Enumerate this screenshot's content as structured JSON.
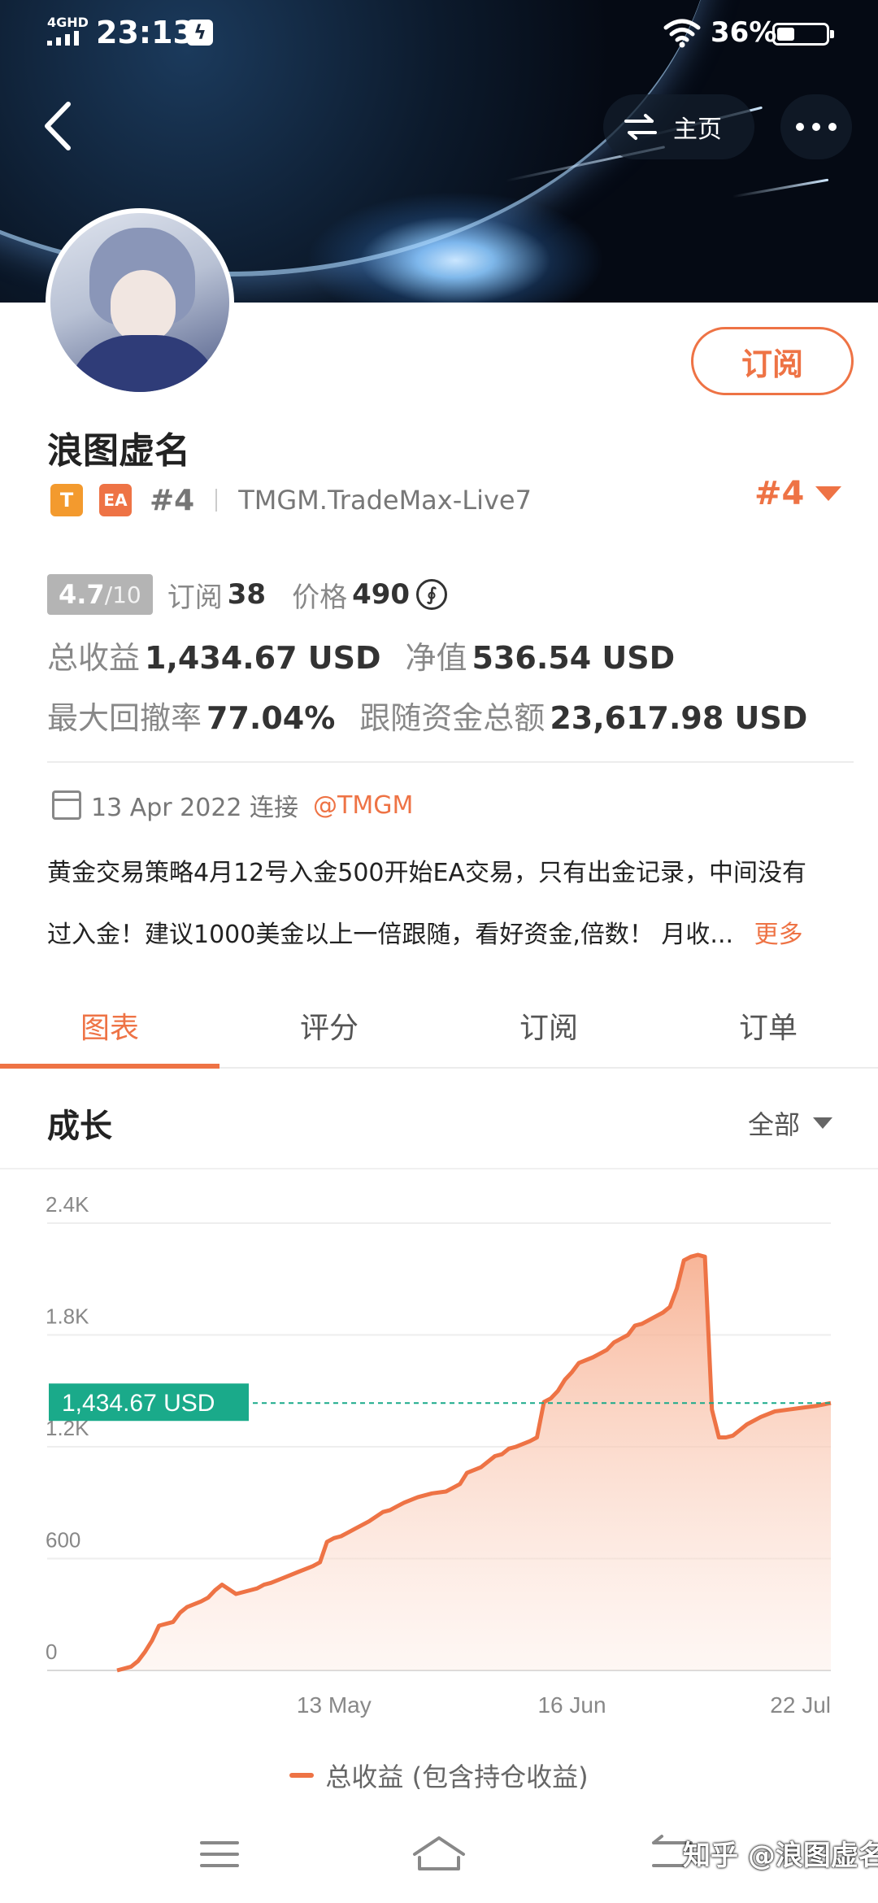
{
  "status_bar": {
    "network": "4GHD",
    "time": "23:13",
    "battery": "36%",
    "battery_level": 0.36
  },
  "top_nav": {
    "home_label": "主页"
  },
  "profile": {
    "name": "浪图虚名",
    "tag_t": "T",
    "tag_ea": "EA",
    "rank_small": "#4",
    "broker": "TMGM.TradeMax-Live7",
    "rank_big": "#4",
    "subscribe_label": "订阅"
  },
  "stats": {
    "score": "4.7",
    "score_max": "/10",
    "subscribe_label": "订阅",
    "subscribe_count": "38",
    "price_label": "价格",
    "price_value": "490",
    "coin_symbol": "∮",
    "total_profit_label": "总收益",
    "total_profit_value": "1,434.67 USD",
    "equity_label": "净值",
    "equity_value": "536.54 USD",
    "drawdown_label": "最大回撤率",
    "drawdown_value": "77.04%",
    "follow_label": "跟随资金总额",
    "follow_value": "23,617.98 USD"
  },
  "since": {
    "date_text": "13 Apr 2022 连接",
    "broker_tag": "@TMGM"
  },
  "description": {
    "line1": "黄金交易策略4月12号入金500开始EA交易，只有出金记录，中间没有",
    "line2": "过入金！建议1000美金以上一倍跟随，看好资金,倍数！ 月收...",
    "more": "更多"
  },
  "tabs": [
    "图表",
    "评分",
    "订阅",
    "订单"
  ],
  "active_tab": 0,
  "section": {
    "title": "成长",
    "range": "全部"
  },
  "chart_data": {
    "type": "area",
    "y_ticks": [
      "2.4K",
      "1.8K",
      "1.2K",
      "600",
      "0"
    ],
    "y_tick_values": [
      2400,
      1800,
      1200,
      600,
      0
    ],
    "ylim": [
      0,
      2400
    ],
    "x_ticks": [
      "13 May",
      "16 Jun",
      "22 Jul"
    ],
    "x_tick_days": [
      31,
      65,
      101
    ],
    "xlim_days": [
      0,
      102
    ],
    "current_label": "1,434.67 USD",
    "current_value": 1434.67,
    "series": [
      {
        "name": "总收益 (包含持仓收益)",
        "color": "#ee7345",
        "days": [
          0,
          2,
          3,
          4,
          5,
          6,
          7,
          8,
          9,
          10,
          12,
          13,
          14,
          15,
          17,
          19,
          20,
          21,
          22,
          24,
          26,
          28,
          29,
          30,
          31,
          32,
          33,
          34,
          36,
          38,
          39,
          40,
          41,
          43,
          45,
          47,
          48,
          49,
          50,
          52,
          54,
          55,
          56,
          57,
          59,
          60,
          61,
          62,
          63,
          64,
          65,
          66,
          68,
          69,
          70,
          71,
          73,
          74,
          75,
          76,
          77,
          78,
          79,
          80,
          81,
          82,
          83,
          84,
          85,
          86,
          87,
          88,
          89,
          90,
          92,
          94,
          96,
          98,
          100,
          102
        ],
        "values": [
          0,
          20,
          50,
          100,
          160,
          240,
          250,
          260,
          310,
          340,
          370,
          390,
          430,
          460,
          410,
          430,
          440,
          460,
          470,
          500,
          530,
          560,
          580,
          690,
          710,
          720,
          740,
          760,
          800,
          850,
          860,
          880,
          900,
          930,
          950,
          960,
          980,
          1000,
          1060,
          1090,
          1150,
          1160,
          1190,
          1200,
          1230,
          1250,
          1440,
          1460,
          1500,
          1560,
          1600,
          1650,
          1680,
          1700,
          1720,
          1760,
          1800,
          1850,
          1860,
          1880,
          1900,
          1920,
          1950,
          2050,
          2200,
          2220,
          2230,
          2220,
          1400,
          1250,
          1250,
          1260,
          1290,
          1320,
          1360,
          1390,
          1400,
          1410,
          1420,
          1434.67
        ]
      }
    ],
    "grid": true
  },
  "legend": {
    "label": "总收益 (包含持仓收益)"
  },
  "watermark": "知乎 @浪图虚名"
}
